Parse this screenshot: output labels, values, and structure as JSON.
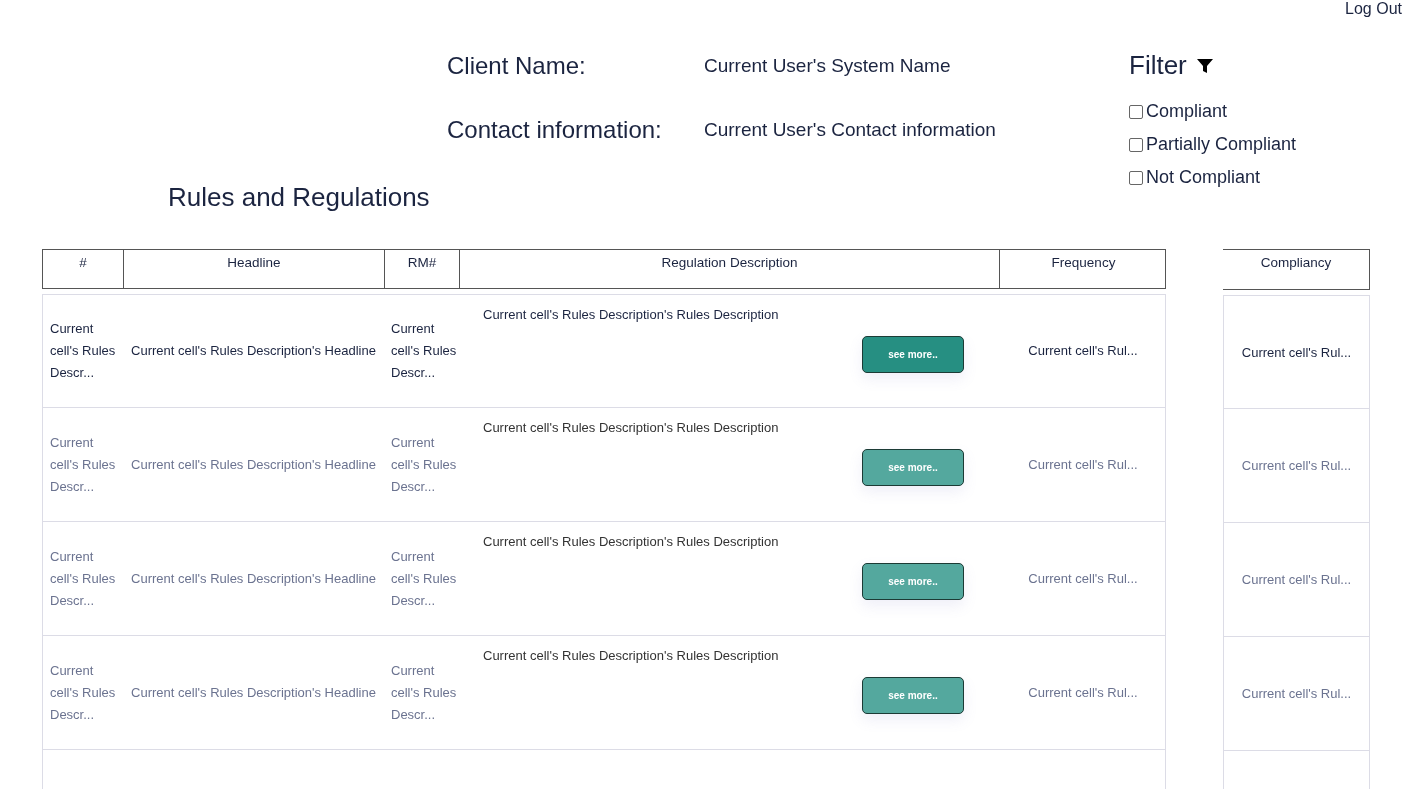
{
  "header": {
    "logout_link": "Log Out",
    "client_label": "Client Name:",
    "client_value": "Current User's System Name",
    "contact_label": "Contact information:",
    "contact_value": "Current User's Contact information"
  },
  "filter": {
    "title": "Filter",
    "options": [
      {
        "label": "Compliant",
        "checked": false
      },
      {
        "label": "Partially Compliant",
        "checked": false
      },
      {
        "label": "Not Compliant",
        "checked": false
      }
    ]
  },
  "section_title": "Rules and Regulations",
  "table": {
    "columns": [
      "#",
      "Headline",
      "RM#",
      "Regulation Description",
      "Frequency"
    ],
    "side_column": "Compliancy",
    "rows": [
      {
        "disabled": false,
        "number": "Current cell's Rules Descr...",
        "headline": "Current cell's Rules Description's Headline",
        "rm": "Current cell's Rules Descr...",
        "description": "Current cell's Rules Description's Rules Description",
        "button": "see more..",
        "frequency": "Current cell's Rul...",
        "compliancy": "Current cell's Rul..."
      },
      {
        "disabled": true,
        "number": "Current cell's Rules Descr...",
        "headline": "Current cell's Rules Description's Headline",
        "rm": "Current cell's Rules Descr...",
        "description": "Current cell's Rules Description's Rules Description",
        "button": "see more..",
        "frequency": "Current cell's Rul...",
        "compliancy": "Current cell's Rul..."
      },
      {
        "disabled": true,
        "number": "Current cell's Rules Descr...",
        "headline": "Current cell's Rules Description's Headline",
        "rm": "Current cell's Rules Descr...",
        "description": "Current cell's Rules Description's Rules Description",
        "button": "see more..",
        "frequency": "Current cell's Rul...",
        "compliancy": "Current cell's Rul..."
      },
      {
        "disabled": true,
        "number": "Current cell's Rules Descr...",
        "headline": "Current cell's Rules Description's Headline",
        "rm": "Current cell's Rules Descr...",
        "description": "Current cell's Rules Description's Rules Description",
        "button": "see more..",
        "frequency": "Current cell's Rul...",
        "compliancy": "Current cell's Rul..."
      }
    ]
  }
}
